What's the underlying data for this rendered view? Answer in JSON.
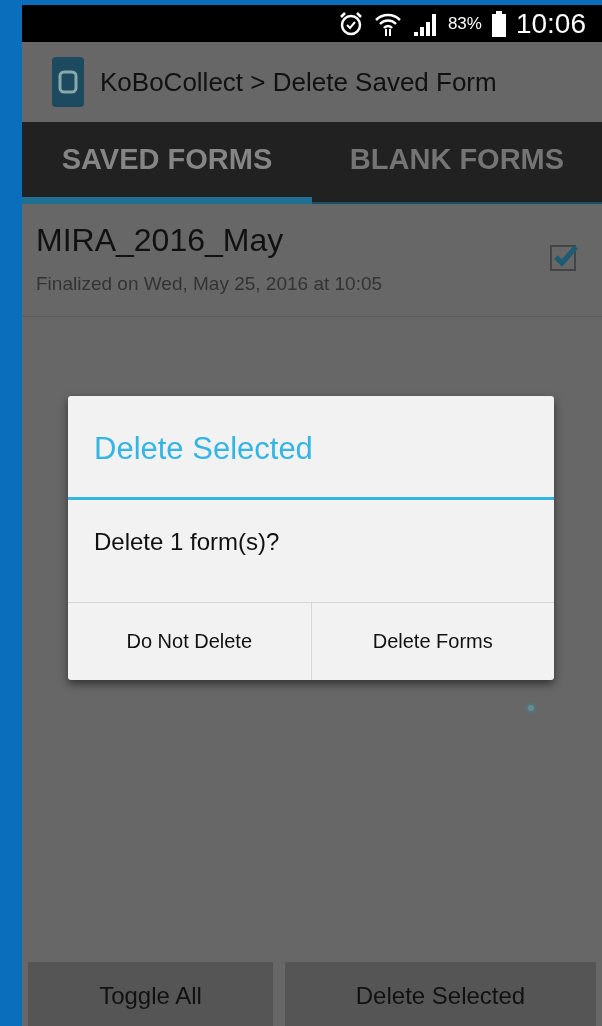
{
  "status_bar": {
    "battery_percent": "83%",
    "time": "10:06"
  },
  "app_bar": {
    "title": "KoBoCollect > Delete Saved Form"
  },
  "tabs": [
    {
      "label": "SAVED FORMS",
      "selected": true
    },
    {
      "label": "BLANK FORMS",
      "selected": false
    }
  ],
  "forms": [
    {
      "name": "MIRA_2016_May",
      "subtitle": "Finalized on Wed, May 25, 2016 at 10:05",
      "checked": true
    }
  ],
  "dialog": {
    "title": "Delete Selected",
    "message": "Delete 1 form(s)?",
    "buttons": [
      "Do Not Delete",
      "Delete Forms"
    ]
  },
  "bottom_buttons": [
    "Toggle All",
    "Delete Selected"
  ]
}
